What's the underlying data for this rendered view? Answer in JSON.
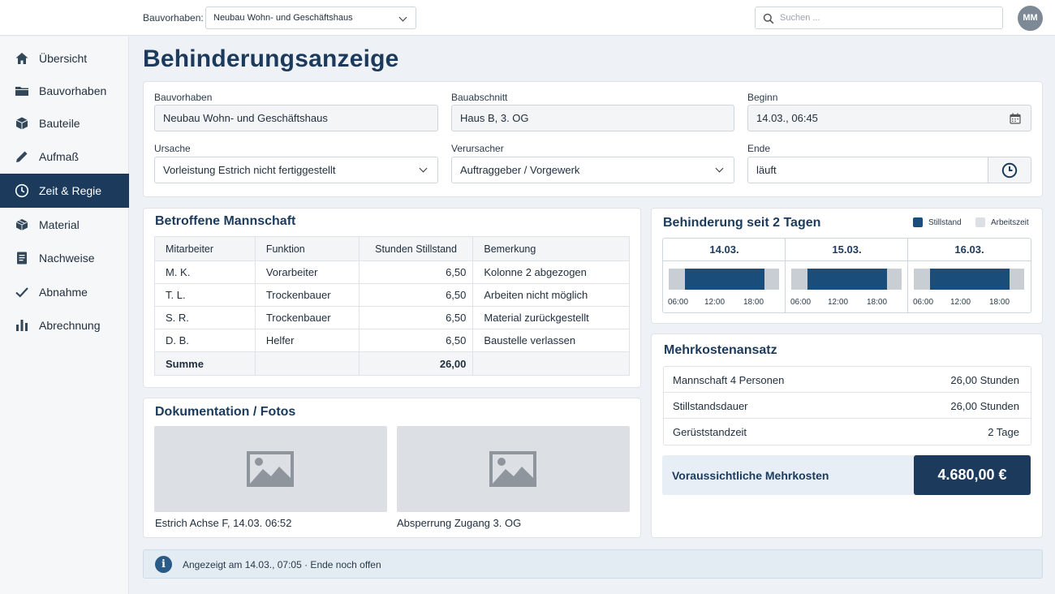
{
  "topbar": {
    "project_label": "Bauvorhaben:",
    "project_value": "Neubau Wohn- und Geschäftshaus",
    "search_placeholder": "Suchen ...",
    "avatar_initials": "MM"
  },
  "sidebar": {
    "items": [
      {
        "label": "Übersicht",
        "icon": "home-icon"
      },
      {
        "label": "Bauvorhaben",
        "icon": "folder-icon"
      },
      {
        "label": "Bauteile",
        "icon": "cube-icon"
      },
      {
        "label": "Aufmaß",
        "icon": "pencil-icon"
      },
      {
        "label": "Zeit & Regie",
        "icon": "clock-icon",
        "active": true
      },
      {
        "label": "Material",
        "icon": "box-icon"
      },
      {
        "label": "Nachweise",
        "icon": "document-icon"
      },
      {
        "label": "Abnahme",
        "icon": "check-icon"
      },
      {
        "label": "Abrechnung",
        "icon": "bar-chart-icon"
      }
    ]
  },
  "page": {
    "title": "Behinderungsanzeige"
  },
  "form": {
    "bauvorhaben_label": "Bauvorhaben",
    "bauvorhaben_value": "Neubau Wohn- und Geschäftshaus",
    "bauabschnitt_label": "Bauabschnitt",
    "bauabschnitt_value": "Haus B, 3. OG",
    "beginn_label": "Beginn",
    "beginn_value": "14.03., 06:45",
    "ursache_label": "Ursache",
    "ursache_value": "Vorleistung Estrich nicht fertiggestellt",
    "verursacher_label": "Verursacher",
    "verursacher_value": "Auftraggeber / Vorgewerk",
    "ende_label": "Ende",
    "ende_value": "läuft"
  },
  "crew": {
    "title": "Betroffene Mannschaft",
    "headers": [
      "Mitarbeiter",
      "Funktion",
      "Stunden Stillstand",
      "Bemerkung"
    ],
    "rows": [
      [
        "M. K.",
        "Vorarbeiter",
        "6,50",
        "Kolonne 2 abgezogen"
      ],
      [
        "T. L.",
        "Trockenbauer",
        "6,50",
        "Arbeiten nicht möglich"
      ],
      [
        "S. R.",
        "Trockenbauer",
        "6,50",
        "Material zurückgestellt"
      ],
      [
        "D. B.",
        "Helfer",
        "6,50",
        "Baustelle verlassen"
      ]
    ],
    "sum_label": "Summe",
    "sum_value": "26,00"
  },
  "timeline": {
    "title": "Behinderung seit 2 Tagen",
    "legend": [
      {
        "label": "Stillstand",
        "color": "#1b4d7a"
      },
      {
        "label": "Arbeitszeit",
        "color": "#dcdfe3"
      }
    ],
    "days": [
      {
        "label": "14.03.",
        "stillstand_from_h": 6.75,
        "stillstand_to_h": 18.0
      },
      {
        "label": "15.03.",
        "stillstand_from_h": 6.75,
        "stillstand_to_h": 18.0
      },
      {
        "label": "16.03.",
        "stillstand_from_h": 6.75,
        "stillstand_to_h": 18.0
      }
    ],
    "ticks": [
      "06:00",
      "12:00",
      "18:00"
    ]
  },
  "costs": {
    "title": "Mehrkostenansatz",
    "rows": [
      {
        "label": "Mannschaft 4 Personen",
        "value": "26,00 Stunden"
      },
      {
        "label": "Stillstandsdauer",
        "value": "26,00 Stunden"
      },
      {
        "label": "Gerüststandzeit",
        "value": "2 Tage"
      }
    ],
    "total_label": "Voraussichtliche Mehrkosten",
    "total_value": "4.680,00 €"
  },
  "photos": {
    "title": "Dokumentation / Fotos",
    "items": [
      {
        "caption": "Estrich Achse F, 14.03. 06:52"
      },
      {
        "caption": "Absperrung Zugang 3. OG"
      }
    ]
  },
  "footer": {
    "text": "Angezeigt am 14.03., 07:05  ·  Ende noch offen"
  },
  "colors": {
    "primary": "#1b3a5c",
    "accent": "#1b4d7a",
    "background": "#eef1f5"
  }
}
